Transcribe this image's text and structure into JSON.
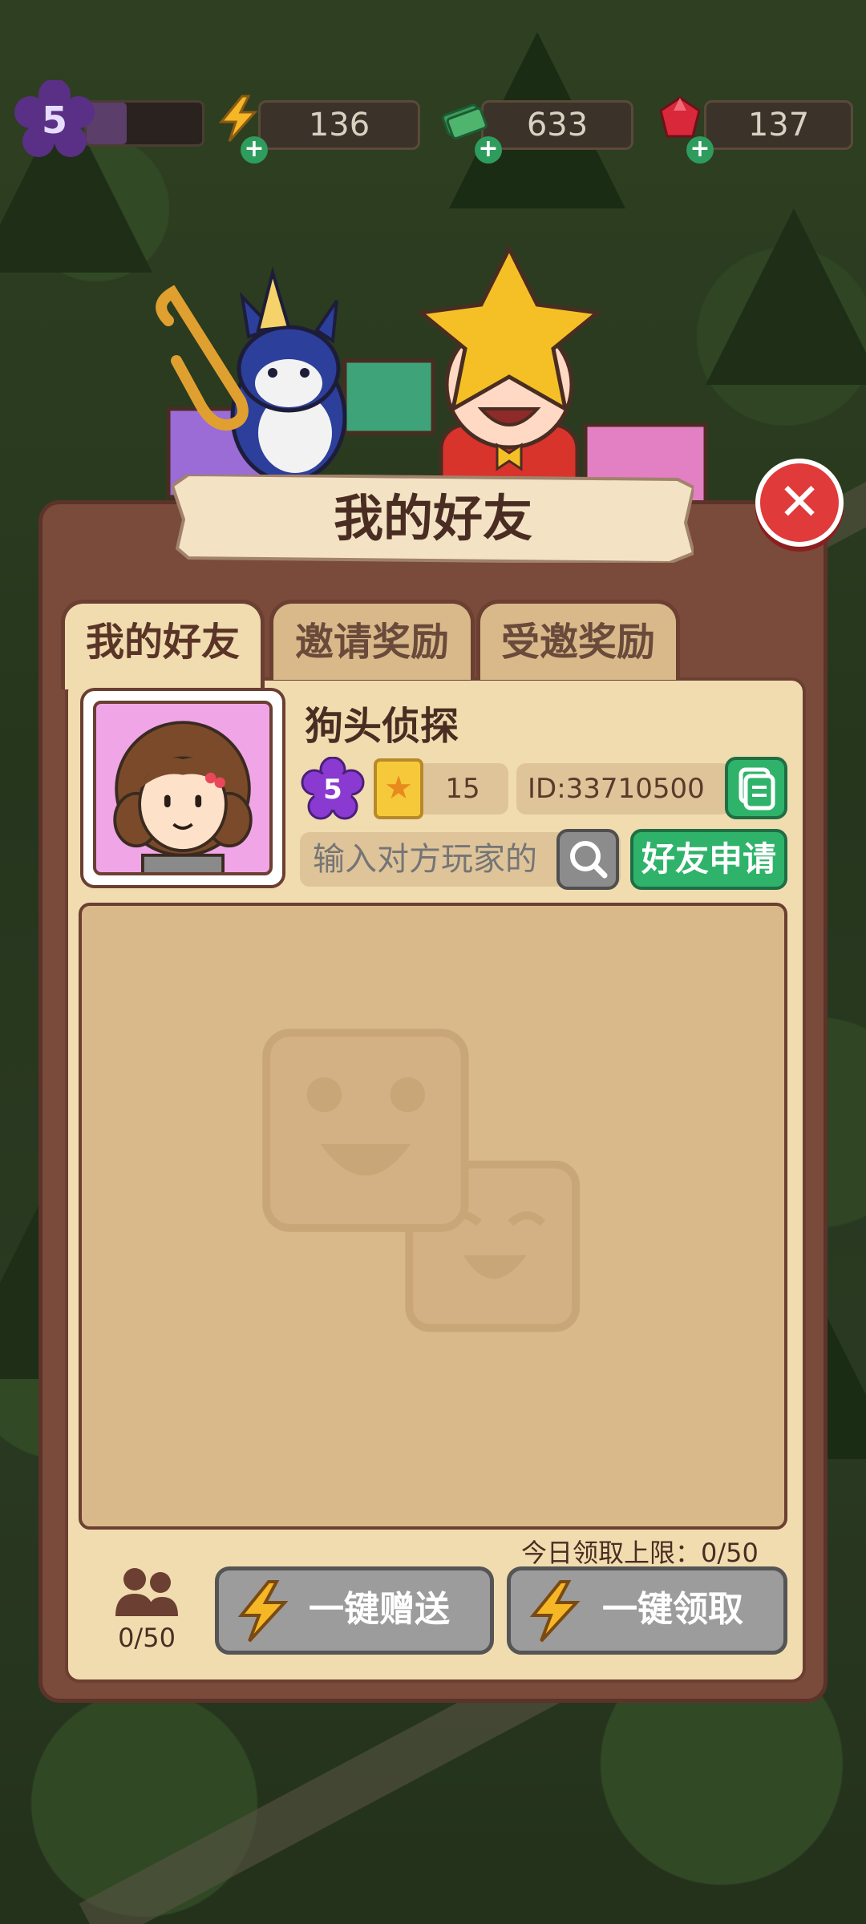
{
  "hud": {
    "level": "5",
    "xp_fraction": 0.35,
    "energy": "136",
    "cash": "633",
    "gems": "137"
  },
  "dialog": {
    "title": "我的好友",
    "tabs": [
      "我的好友",
      "邀请奖励",
      "受邀奖励"
    ],
    "active_tab": 0
  },
  "profile": {
    "name": "狗头侦探",
    "level": "5",
    "cards": "15",
    "id": "ID:33710500"
  },
  "search": {
    "placeholder": "输入对方玩家的",
    "apply_label": "好友申请"
  },
  "friends": {
    "claim_limit": "今日领取上限：0/50",
    "count": "0/50",
    "gift_all": "一键赠送",
    "claim_all": "一键领取"
  },
  "colors": {
    "accent_green": "#2fb36a",
    "panel_brown": "#7a4a3a",
    "parchment": "#f1dcb0",
    "close_red": "#e03a3a"
  }
}
